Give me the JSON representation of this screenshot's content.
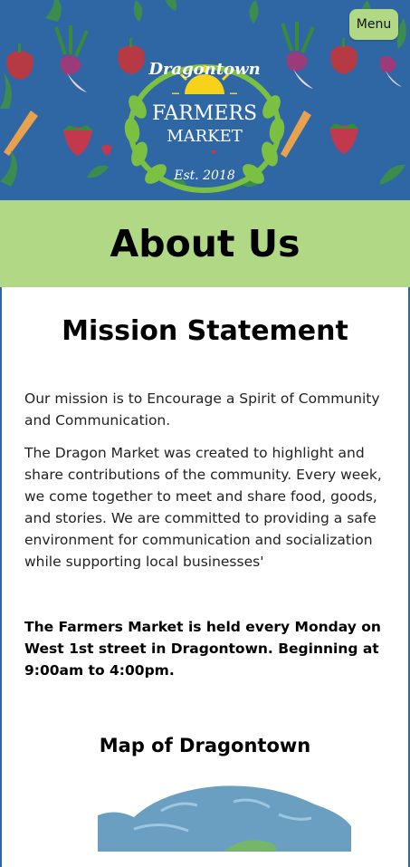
{
  "header": {
    "menu_label": "Menu",
    "logo": {
      "top_text": "Dragontown",
      "line1": "FARMERS",
      "line2": "MARKET",
      "est": "Est. 2018"
    },
    "background_color": "#2f67a4"
  },
  "page": {
    "title": "About Us",
    "accent_color": "#b1d884"
  },
  "mission": {
    "title": "Mission Statement",
    "paragraph1": "Our mission is to Encourage a Spirit of Community and Communication.",
    "paragraph2": "The Dragon Market was created to highlight and share contributions of the community. Every week, we come together to meet and share food, goods, and stories. We are committed to providing a safe environment for communication and socialization while supporting local businesses'",
    "schedule": "The Farmers Market is held every Monday on West 1st street in Dragontown. Beginning at 9:00am to 4:00pm."
  },
  "map": {
    "title": "Map of Dragontown"
  }
}
